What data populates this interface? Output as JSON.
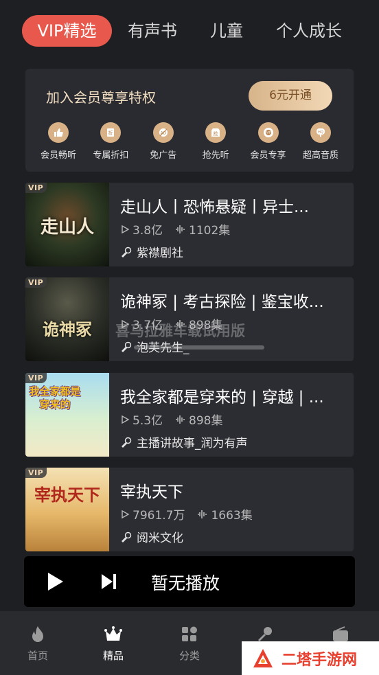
{
  "tabs": [
    {
      "label": "VIP精选",
      "active": true
    },
    {
      "label": "有声书"
    },
    {
      "label": "儿童"
    },
    {
      "label": "个人成长"
    }
  ],
  "vip": {
    "title": "加入会员尊享特权",
    "button": "6元开通",
    "perks": [
      {
        "label": "会员畅听",
        "icon": "thumbs-up-icon"
      },
      {
        "label": "专属折扣",
        "icon": "discount-tag-icon"
      },
      {
        "label": "免广告",
        "icon": "no-ads-icon"
      },
      {
        "label": "抢先听",
        "icon": "early-access-icon"
      },
      {
        "label": "会员专享",
        "icon": "vip-disc-icon"
      },
      {
        "label": "超高音质",
        "icon": "hq-audio-icon"
      }
    ]
  },
  "items": [
    {
      "title": "走山人丨恐怖悬疑丨异士...",
      "plays": "3.8亿",
      "episodes": "1102集",
      "author": "紫襟剧社",
      "cover_text": "走山人",
      "badge": "VIP"
    },
    {
      "title": "诡神冢 | 考古探险 | 鉴宝收...",
      "plays": "3.7亿",
      "episodes": "898集",
      "author": "泡芙先生_",
      "cover_text": "诡神冢",
      "badge": "VIP"
    },
    {
      "title": "我全家都是穿来的 | 穿越 | ...",
      "plays": "5.3亿",
      "episodes": "898集",
      "author": "主播讲故事_润为有声",
      "cover_text": "我全家都是穿来的",
      "badge": "VIP"
    },
    {
      "title": "宰执天下",
      "plays": "7961.7万",
      "episodes": "1663集",
      "author": "阅米文化",
      "cover_text": "宰执天下",
      "badge": "VIP"
    }
  ],
  "watermark": "喜马拉雅车载试用版",
  "player": {
    "status": "暂无播放"
  },
  "nav": [
    {
      "label": "首页",
      "icon": "flame-icon"
    },
    {
      "label": "精品",
      "icon": "crown-icon",
      "active": true
    },
    {
      "label": "分类",
      "icon": "category-grid-icon"
    },
    {
      "label": "",
      "icon": "microphone-icon"
    },
    {
      "label": "",
      "icon": "radio-icon"
    }
  ],
  "brand": {
    "text": "二塔手游网"
  },
  "colors": {
    "accent": "#e9584c",
    "gold": "#d8b187",
    "background": "#1e1f23"
  }
}
